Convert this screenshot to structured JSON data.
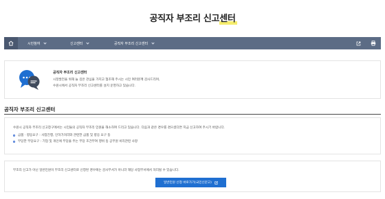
{
  "header": {
    "title": "공직자 부조리 신고센터"
  },
  "nav": {
    "items": [
      {
        "label": "시민참여"
      },
      {
        "label": "신고센터"
      },
      {
        "label": "공직자 부조리 신고센터"
      }
    ]
  },
  "intro": {
    "title": "공직자 부조리 신고센터",
    "desc_lines": [
      "시정발전을 위해 늘 깊은 관심을 가지고 협조해 주시는 시민 여러분께 감사드리며,",
      "수원시에서 공직자 부조리 신고센터를 설치 운영하고 있습니다."
    ]
  },
  "section": {
    "title": "공직자 부조리 신고센터"
  },
  "content": {
    "paragraph": "수원시 공직자 부조리 신고창구에서는 시민들의 공직자 부조리 민원을 해소하여 드리고 있습니다. 다음과 같은 경우를 겪으셨다면 지금 신고하여 주시기 바랍니다.",
    "bullets": [
      "금품 · 향응요구 : 사업진행, 인허가처리와 관련한 금품 및 향응 요구 등",
      "부당한 부당요구 : 기업 및 개인에 부당을 주는 부당 조건부여 행위 등 공무원 비리관련 사항"
    ]
  },
  "notice": {
    "text": "부조리 신고가 아닌 일반민원이 부조리 신고센터로 신청된 경우에는 감사부서가 아니라 해당 사업부서에서 처리될 수 있습니다.",
    "button_label": "일반민원 신청 바로가기(국민신문고)"
  },
  "colors": {
    "nav_bg": "#5c6c85",
    "accent": "#1f6fd1",
    "title_highlight": "#f2e94a"
  }
}
